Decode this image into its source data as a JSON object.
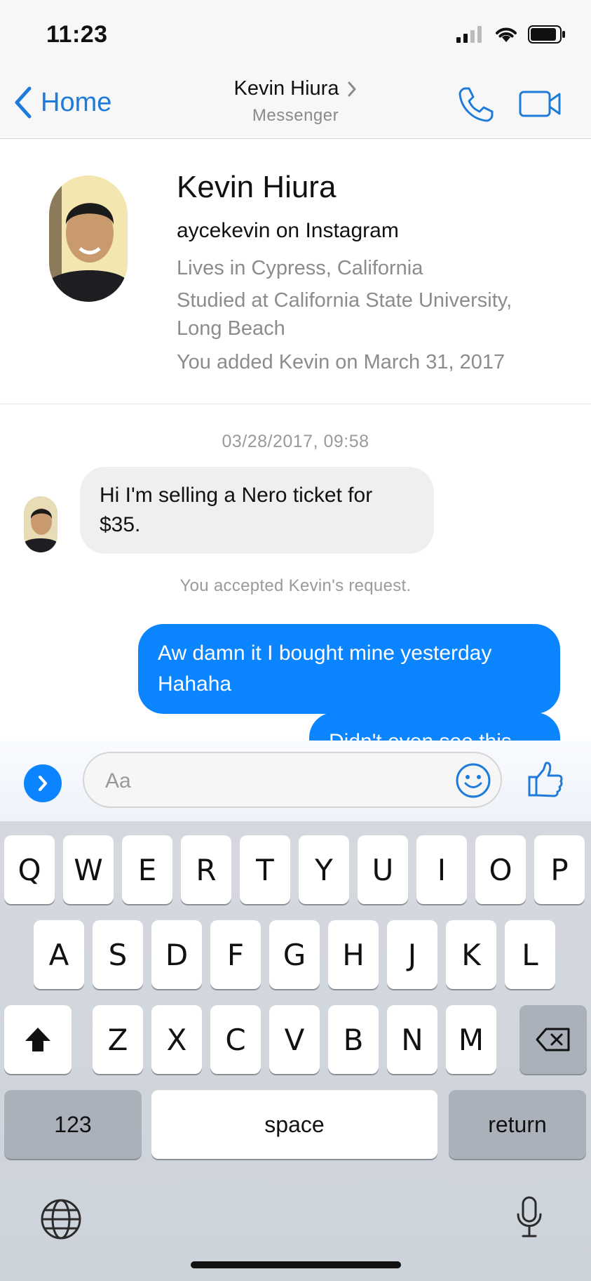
{
  "status_bar": {
    "time": "11:23"
  },
  "nav": {
    "back_label": "Home",
    "title": "Kevin Hiura",
    "subtitle": "Messenger"
  },
  "profile": {
    "name": "Kevin Hiura",
    "instagram": "aycekevin on Instagram",
    "lives": "Lives in Cypress, California",
    "studied_line1": "Studied at California State University,",
    "studied_line2": "Long Beach",
    "added": "You added Kevin on March 31, 2017"
  },
  "thread": {
    "timestamp": "03/28/2017, 09:58",
    "incoming_message": "Hi I'm selling a Nero ticket for $35.",
    "system_note": "You accepted Kevin's request.",
    "outgoing_message_1": "Aw damn it I bought mine yesterday Hahaha",
    "outgoing_message_2": "Didn't even see this"
  },
  "composer": {
    "placeholder": "Aa"
  },
  "keyboard": {
    "row1": [
      "Q",
      "W",
      "E",
      "R",
      "T",
      "Y",
      "U",
      "I",
      "O",
      "P"
    ],
    "row2": [
      "A",
      "S",
      "D",
      "F",
      "G",
      "H",
      "J",
      "K",
      "L"
    ],
    "row3": [
      "Z",
      "X",
      "C",
      "V",
      "B",
      "N",
      "M"
    ],
    "numbers_label": "123",
    "space_label": "space",
    "return_label": "return"
  },
  "colors": {
    "accent": "#0a84ff",
    "nav_blue": "#1f7bd9",
    "incoming_bubble": "#efefef"
  },
  "icons": [
    "back-chevron-icon",
    "chevron-right-icon",
    "phone-icon",
    "video-camera-icon",
    "signal-icon",
    "wifi-icon",
    "battery-icon",
    "expand-chevron-icon",
    "emoji-icon",
    "thumbs-up-icon",
    "shift-icon",
    "delete-icon",
    "globe-icon",
    "microphone-icon"
  ]
}
